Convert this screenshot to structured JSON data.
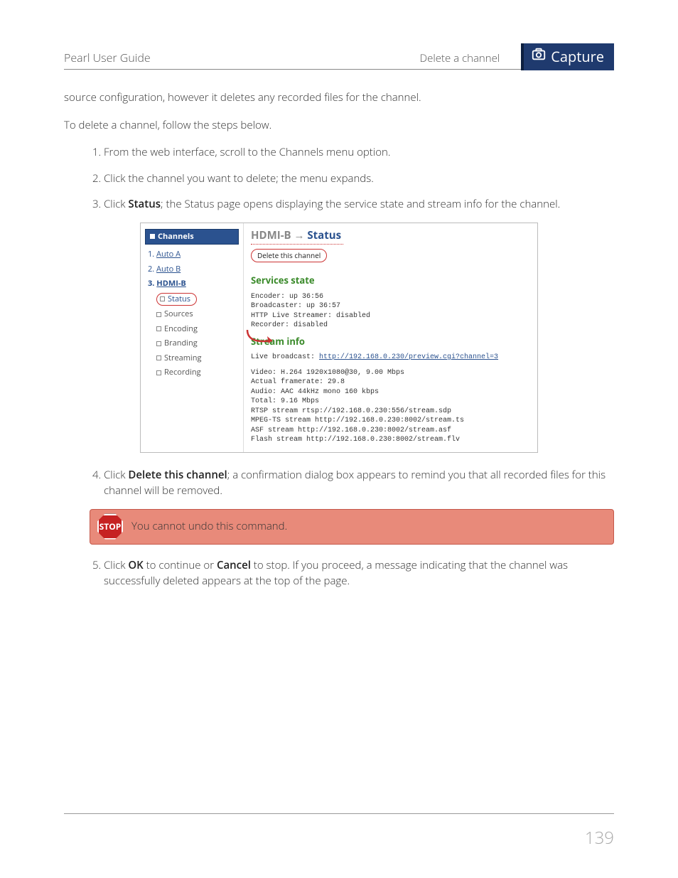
{
  "header": {
    "guide_title": "Pearl User Guide",
    "section_title": "Delete a channel",
    "tab_label": "Capture"
  },
  "intro": {
    "p1": "source configuration, however it deletes any recorded files for the channel.",
    "p2": "To delete a channel, follow the steps below."
  },
  "steps": {
    "s1": "From the web interface, scroll to the Channels menu option.",
    "s2": "Click the channel you want to delete; the menu expands.",
    "s3_pre": "Click ",
    "s3_bold": "Status",
    "s3_post": "; the Status page opens displaying the service state and stream info for the channel.",
    "s4_pre": "Click ",
    "s4_bold": "Delete this channel",
    "s4_post": "; a confirmation dialog box appears to remind you that all recorded files for this channel will be removed.",
    "s5_pre": "Click ",
    "s5_b1": "OK",
    "s5_mid": " to continue or ",
    "s5_b2": "Cancel",
    "s5_post": " to stop. If you proceed, a message indicating that the channel was successfully deleted appears at the top of the page."
  },
  "figure": {
    "sidebar": {
      "header": "Channels",
      "items": [
        {
          "n": "1.",
          "label": "Auto A"
        },
        {
          "n": "2.",
          "label": "Auto B"
        },
        {
          "n": "3.",
          "label": "HDMI-B"
        }
      ],
      "sub": [
        "Status",
        "Sources",
        "Encoding",
        "Branding",
        "Streaming",
        "Recording"
      ]
    },
    "main": {
      "title_grey": "HDMI-B → ",
      "title_blue": "Status",
      "delete_btn": "Delete this channel",
      "section1": "Services state",
      "services": "Encoder: up 36:56\nBroadcaster: up 36:57\nHTTP Live Streamer: disabled\nRecorder: disabled",
      "section2": "Stream info",
      "live_label": "Live broadcast: ",
      "live_url": "http://192.168.0.230/preview.cgi?channel=3",
      "info": "Video: H.264 1920x1080@30, 9.00 Mbps\nActual framerate: 29.8\nAudio: AAC 44kHz mono 160 kbps\nTotal: 9.16 Mbps\nRTSP stream rtsp://192.168.0.230:556/stream.sdp\nMPEG-TS stream http://192.168.0.230:8002/stream.ts\nASF stream http://192.168.0.230:8002/stream.asf\nFlash stream http://192.168.0.230:8002/stream.flv"
    }
  },
  "callout": {
    "stop_label": "STOP",
    "text": "You cannot undo this command."
  },
  "page_number": "139"
}
